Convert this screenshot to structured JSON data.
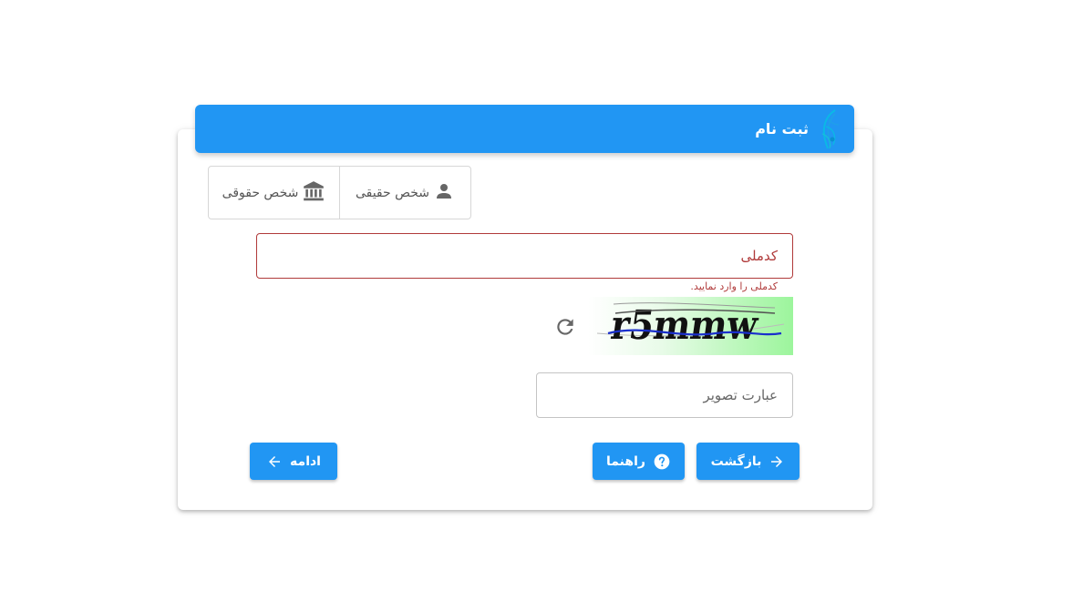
{
  "header": {
    "title": "ثبت نام",
    "logo_icon": "peacock-feather-icon"
  },
  "person_type": {
    "natural_label": "شخص حقیقی",
    "natural_icon": "person-icon",
    "legal_label": "شخص حقوقی",
    "legal_icon": "bank-icon"
  },
  "national_code": {
    "label": "کدملی",
    "error": "کدملی را وارد نمایید."
  },
  "captcha": {
    "text": "r5mmw",
    "refresh_icon": "refresh-icon",
    "input_placeholder": "عبارت تصویر"
  },
  "buttons": {
    "back_label": "بازگشت",
    "help_label": "راهنما",
    "continue_label": "ادامه"
  },
  "colors": {
    "primary": "#2196f3",
    "error": "#b03a3a"
  }
}
